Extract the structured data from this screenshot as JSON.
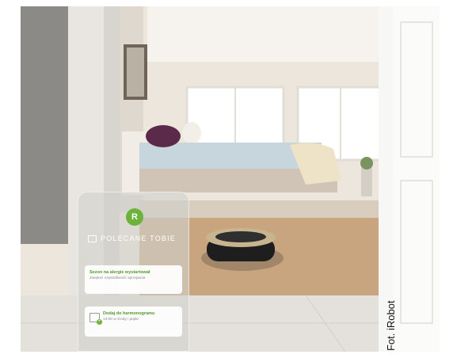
{
  "app": {
    "logo_glyph": "R",
    "section_title": "POLECANE TOBIE",
    "cards": [
      {
        "title": "Sezon na alergie wystartował",
        "subtitle": "Zwiększ częstotliwość sprzątania"
      },
      {
        "title": "Dodaj do harmonogramu",
        "subtitle": "13:00 w środy i piątki"
      }
    ]
  },
  "photo_credit": "Fot. iRobot",
  "colors": {
    "accent_green": "#6bb33a",
    "card_title_green": "#4f9a2a"
  },
  "icons": [
    "list-icon",
    "calendar-add-icon"
  ]
}
